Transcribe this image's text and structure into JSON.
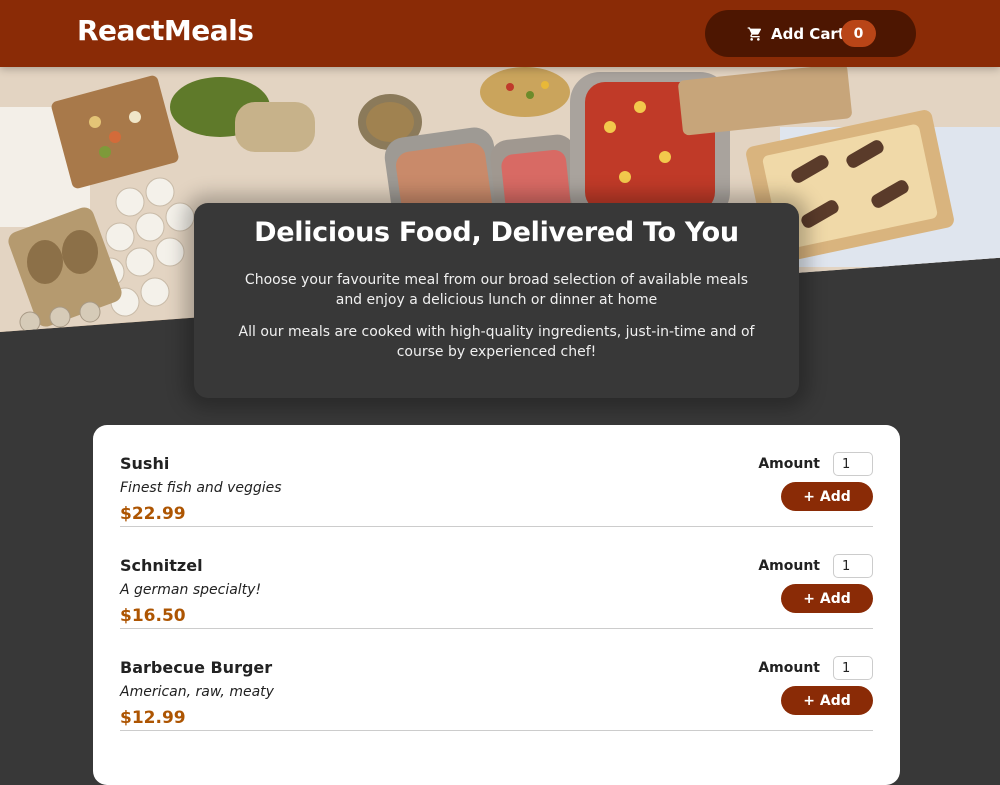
{
  "header": {
    "brand": "ReactMeals",
    "cart_label": "Add Cart",
    "cart_count": "0",
    "cart_icon": "shopping-cart-icon"
  },
  "hero": {
    "image": "buffet-table-photo"
  },
  "summary": {
    "title": "Delicious Food, Delivered To You",
    "paragraph1": "Choose your favourite meal from our broad selection of available meals and enjoy a delicious lunch or dinner at home",
    "paragraph2": "All our meals are cooked with high-quality ingredients, just-in-time and of course by experienced chef!"
  },
  "meals": [
    {
      "name": "Sushi",
      "description": "Finest fish and veggies",
      "price": "$22.99",
      "amount_label": "Amount",
      "amount": "1",
      "add_label": "+ Add"
    },
    {
      "name": "Schnitzel",
      "description": "A german specialty!",
      "price": "$16.50",
      "amount_label": "Amount",
      "amount": "1",
      "add_label": "+ Add"
    },
    {
      "name": "Barbecue Burger",
      "description": "American, raw, meaty",
      "price": "$12.99",
      "amount_label": "Amount",
      "amount": "1",
      "add_label": "+ Add"
    }
  ],
  "colors": {
    "header_bg": "#8a2b06",
    "cart_bg": "#4d1601",
    "badge_bg": "#b94517",
    "page_bg": "#383838",
    "price": "#ad5502"
  }
}
